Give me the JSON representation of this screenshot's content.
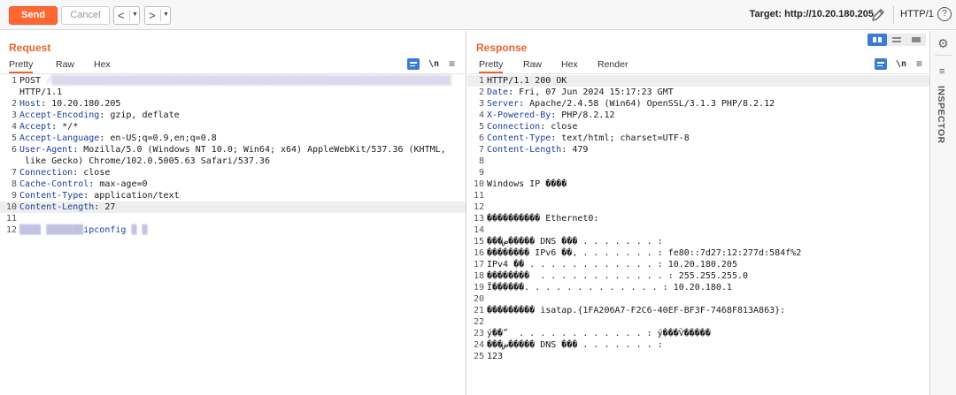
{
  "toolbar": {
    "send_label": "Send",
    "cancel_label": "Cancel",
    "back_arrow": "<",
    "forward_arrow": ">",
    "target": "Target: http://10.20.180.205",
    "http_version": "HTTP/1",
    "help": "?"
  },
  "request": {
    "title": "Request",
    "tabs": [
      "Pretty",
      "Raw",
      "Hex"
    ],
    "active_tab": "Pretty",
    "lines": [
      {
        "n": "1",
        "parts": [
          [
            "POST ",
            ""
          ],
          [
            "/▒▒▒▒▒▒▒▒▒▒▒▒▒▒▒▒▒▒▒▒▒▒▒▒▒▒▒▒▒▒▒▒▒▒▒▒▒▒▒▒▒▒▒▒▒▒▒▒▒▒▒▒▒▒▒▒▒▒▒▒▒▒▒▒▒▒▒▒▒▒▒▒▒▒▒",
            "blur"
          ]
        ]
      },
      {
        "n": "",
        "parts": [
          [
            "HTTP/1.1",
            ""
          ]
        ]
      },
      {
        "n": "2",
        "parts": [
          [
            "Host",
            "k"
          ],
          [
            ": 10.20.180.205",
            ""
          ]
        ]
      },
      {
        "n": "3",
        "parts": [
          [
            "Accept-Encoding",
            "k"
          ],
          [
            ": gzip, deflate",
            ""
          ]
        ]
      },
      {
        "n": "4",
        "parts": [
          [
            "Accept",
            "k"
          ],
          [
            ": */*",
            ""
          ]
        ]
      },
      {
        "n": "5",
        "parts": [
          [
            "Accept-Language",
            "k"
          ],
          [
            ": en-US;q=0.9,en;q=0.8",
            ""
          ]
        ]
      },
      {
        "n": "6",
        "parts": [
          [
            "User-Agent",
            "k"
          ],
          [
            ": Mozilla/5.0 (Windows NT 10.0; Win64; x64) AppleWebKit/537.36 (KHTML,",
            ""
          ]
        ]
      },
      {
        "n": "",
        "parts": [
          [
            " like Gecko) Chrome/102.0.5005.63 Safari/537.36",
            ""
          ]
        ]
      },
      {
        "n": "7",
        "parts": [
          [
            "Connection",
            "k"
          ],
          [
            ": close",
            ""
          ]
        ]
      },
      {
        "n": "8",
        "parts": [
          [
            "Cache-Control",
            "k"
          ],
          [
            ": max-age=0",
            ""
          ]
        ]
      },
      {
        "n": "9",
        "parts": [
          [
            "Content-Type",
            "k"
          ],
          [
            ": application/text",
            ""
          ]
        ]
      },
      {
        "n": "10",
        "hl": true,
        "parts": [
          [
            "Content-Length",
            "k"
          ],
          [
            ": 27",
            ""
          ]
        ]
      },
      {
        "n": "11",
        "parts": []
      },
      {
        "n": "12",
        "parts": [
          [
            "▒▒▒▒ ▒▒▒▒▒▒▒",
            "blur2"
          ],
          [
            "ipconfig",
            "k"
          ],
          [
            " ▒ ▒",
            "blur2"
          ]
        ]
      }
    ]
  },
  "response": {
    "title": "Response",
    "tabs": [
      "Pretty",
      "Raw",
      "Hex",
      "Render"
    ],
    "active_tab": "Pretty",
    "lines": [
      {
        "n": "1",
        "hl": true,
        "parts": [
          [
            "HTTP/1.1 200 OK",
            ""
          ]
        ]
      },
      {
        "n": "2",
        "parts": [
          [
            "Date",
            "k"
          ],
          [
            ": Fri, 07 Jun 2024 15:17:23 GMT",
            ""
          ]
        ]
      },
      {
        "n": "3",
        "parts": [
          [
            "Server",
            "k"
          ],
          [
            ": Apache/2.4.58 (Win64) OpenSSL/3.1.3 PHP/8.2.12",
            ""
          ]
        ]
      },
      {
        "n": "4",
        "parts": [
          [
            "X-Powered-By",
            "k"
          ],
          [
            ": PHP/8.2.12",
            ""
          ]
        ]
      },
      {
        "n": "5",
        "parts": [
          [
            "Connection",
            "k"
          ],
          [
            ": close",
            ""
          ]
        ]
      },
      {
        "n": "6",
        "parts": [
          [
            "Content-Type",
            "k"
          ],
          [
            ": text/html; charset=UTF-8",
            ""
          ]
        ]
      },
      {
        "n": "7",
        "parts": [
          [
            "Content-Length",
            "k"
          ],
          [
            ": 479",
            ""
          ]
        ]
      },
      {
        "n": "8",
        "parts": []
      },
      {
        "n": "9",
        "parts": []
      },
      {
        "n": "10",
        "parts": [
          [
            "Windows IP ����",
            ""
          ]
        ]
      },
      {
        "n": "11",
        "parts": []
      },
      {
        "n": "12",
        "parts": []
      },
      {
        "n": "13",
        "parts": [
          [
            "���������� Ethernet0:",
            ""
          ]
        ]
      },
      {
        "n": "14",
        "parts": []
      },
      {
        "n": "15",
        "parts": [
          [
            "���ض����� DNS ��� . . . . . . . :",
            ""
          ]
        ]
      },
      {
        "n": "16",
        "parts": [
          [
            "�������� IPv6 ��ַ. . . . . . . . : fe80::7d27:12:277d:584f%2",
            ""
          ]
        ]
      },
      {
        "n": "17",
        "parts": [
          [
            "IPv4 �� . . . . . . . . . . . . : 10.20.180.205",
            ""
          ]
        ]
      },
      {
        "n": "18",
        "parts": [
          [
            "��������  . . . . . . . . . . . . : 255.255.255.0",
            ""
          ]
        ]
      },
      {
        "n": "19",
        "parts": [
          [
            "Ĭ������. . . . . . . . . . . . . : 10.20.180.1",
            ""
          ]
        ]
      },
      {
        "n": "20",
        "parts": []
      },
      {
        "n": "21",
        "parts": [
          [
            "��������� isatap.{1FA206A7-F2C6-40EF-BF3F-7468F813A863}:",
            ""
          ]
        ]
      },
      {
        "n": "22",
        "parts": []
      },
      {
        "n": "23",
        "parts": [
          [
            "ý��״  . . . . . . . . . . . . : ý���Ѷ�����",
            ""
          ]
        ]
      },
      {
        "n": "24",
        "parts": [
          [
            "���ض����� DNS ��� . . . . . . . :",
            ""
          ]
        ]
      },
      {
        "n": "25",
        "parts": [
          [
            "123",
            ""
          ]
        ]
      }
    ]
  },
  "inspector": {
    "label": "INSPECTOR"
  },
  "colors": {
    "accent": "#ff6633",
    "title": "#e8642c",
    "key": "#1a3fa0",
    "toggle_blue": "#3a7bd5"
  }
}
